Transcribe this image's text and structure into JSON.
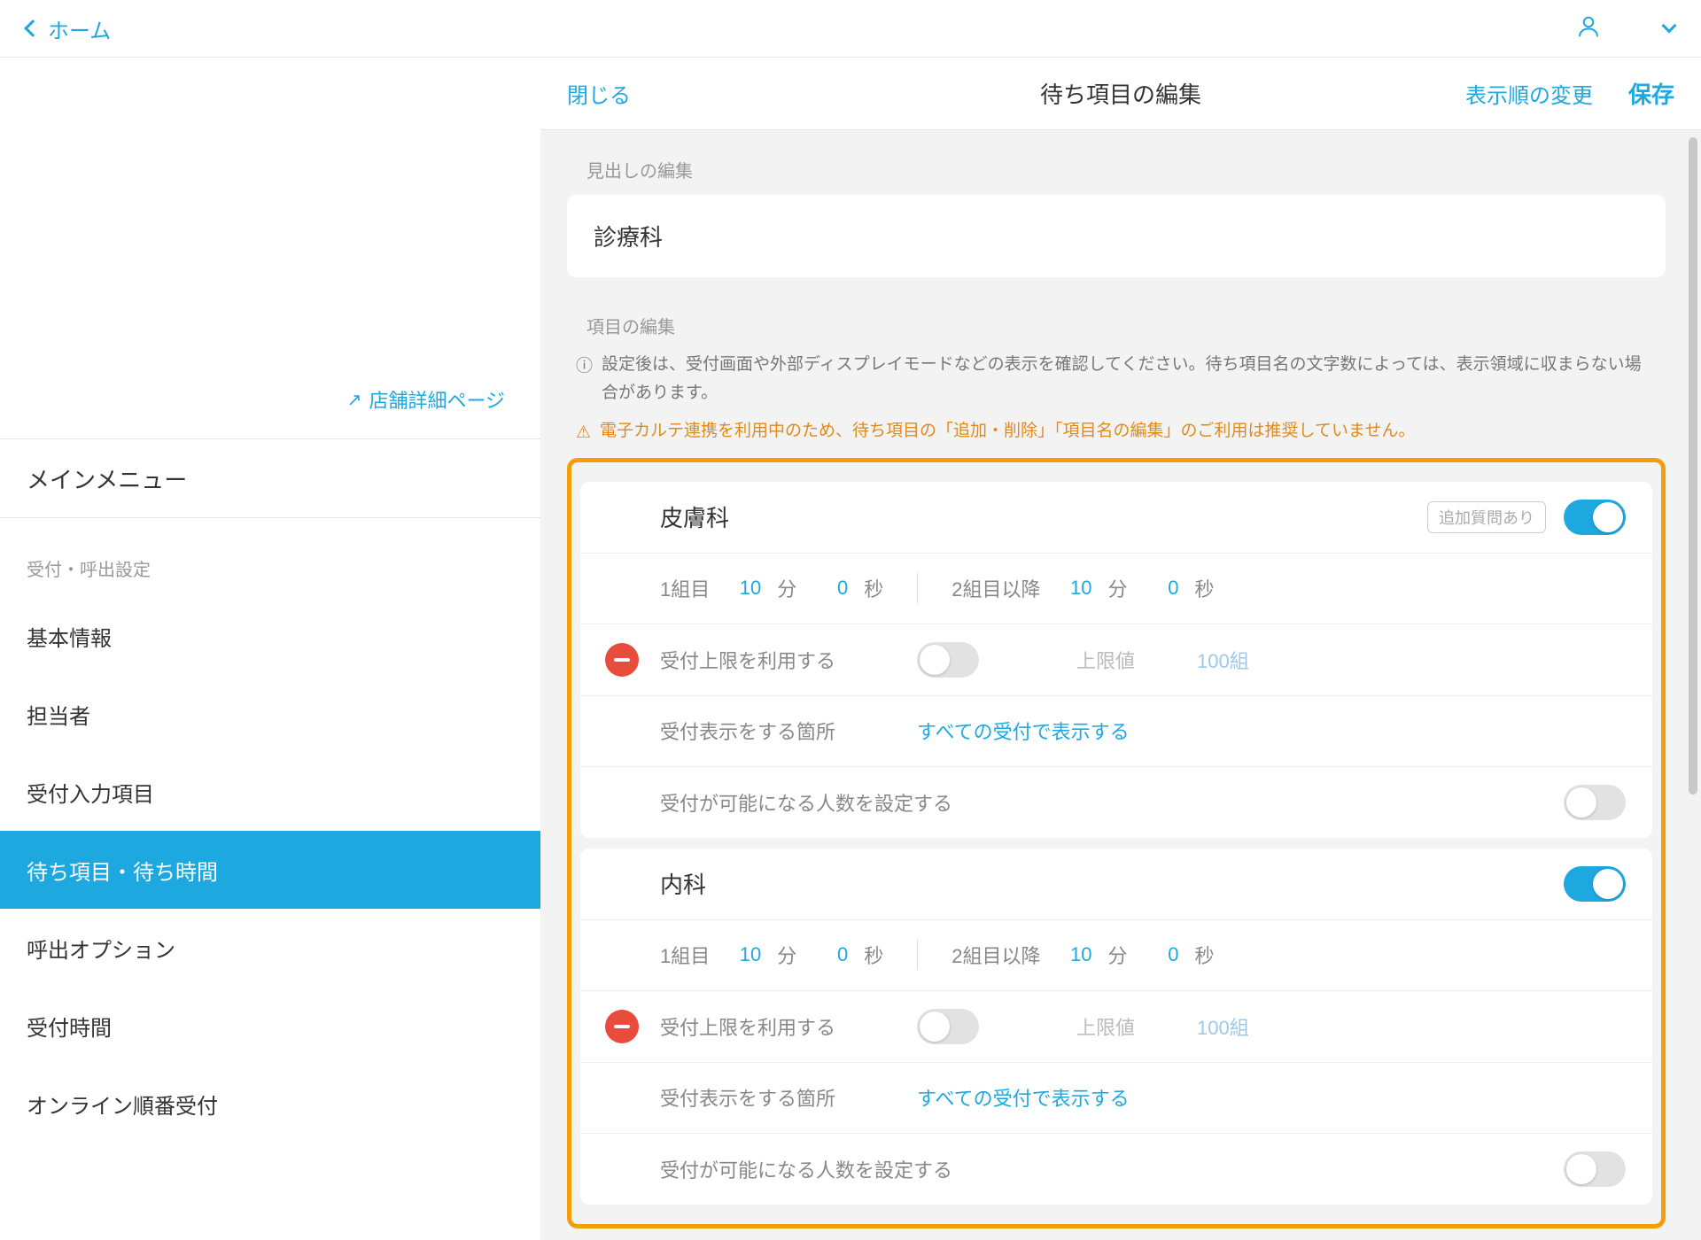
{
  "topbar": {
    "home": "ホーム"
  },
  "sidebar": {
    "store_link": "店舗詳細ページ",
    "main_menu": "メインメニュー",
    "section_label": "受付・呼出設定",
    "items": [
      "基本情報",
      "担当者",
      "受付入力項目",
      "待ち項目・待ち時間",
      "呼出オプション",
      "受付時間",
      "オンライン順番受付"
    ]
  },
  "header": {
    "close": "閉じる",
    "title": "待ち項目の編集",
    "reorder": "表示順の変更",
    "save": "保存"
  },
  "heading": {
    "label": "見出しの編集",
    "value": "診療科"
  },
  "items_section": {
    "label": "項目の編集",
    "info": "設定後は、受付画面や外部ディスプレイモードなどの表示を確認してください。待ち項目名の文字数によっては、表示領域に収まらない場合があります。",
    "warn": "電子カルテ連携を利用中のため、待ち項目の「追加・削除」「項目名の編集」のご利用は推奨していません。"
  },
  "labels": {
    "group1": "1組目",
    "group2": "2組目以降",
    "min": "分",
    "sec": "秒",
    "limit_use": "受付上限を利用する",
    "limit_label": "上限値",
    "limit_unit": "組",
    "display_where": "受付表示をする箇所",
    "display_all": "すべての受付で表示する",
    "capacity": "受付が可能になる人数を設定する",
    "badge_question": "追加質問あり"
  },
  "cards": [
    {
      "name": "皮膚科",
      "has_badge": true,
      "enabled": true,
      "g1_min": "10",
      "g1_sec": "0",
      "g2_min": "10",
      "g2_sec": "0",
      "limit_on": false,
      "limit_val": "100",
      "capacity_on": false
    },
    {
      "name": "内科",
      "has_badge": false,
      "enabled": true,
      "g1_min": "10",
      "g1_sec": "0",
      "g2_min": "10",
      "g2_sec": "0",
      "limit_on": false,
      "limit_val": "100",
      "capacity_on": false
    }
  ]
}
